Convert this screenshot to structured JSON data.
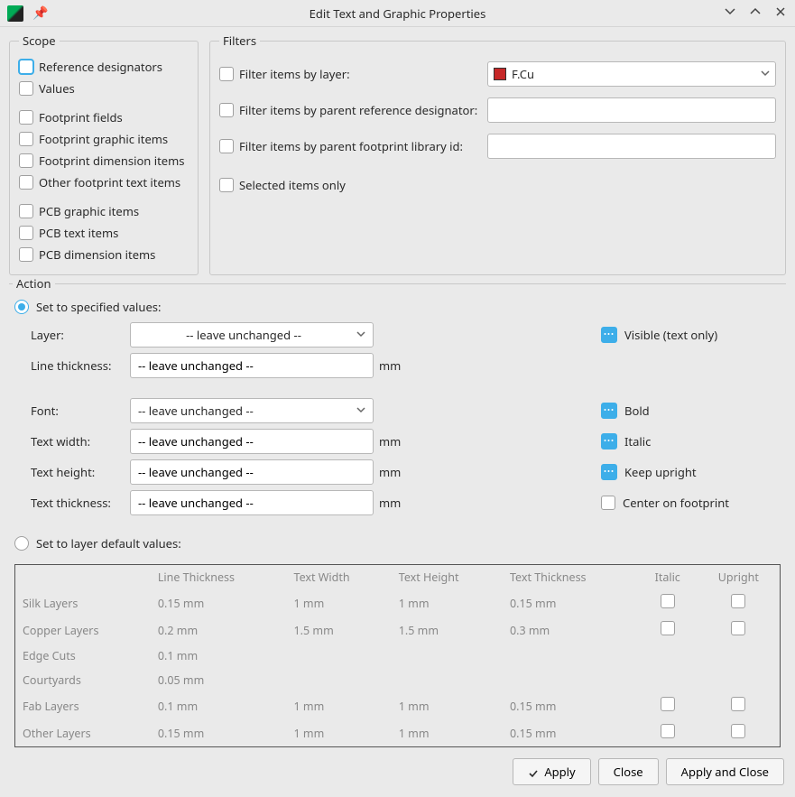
{
  "window": {
    "title": "Edit Text and Graphic Properties"
  },
  "scope": {
    "legend": "Scope",
    "items": [
      {
        "label": "Reference designators"
      },
      {
        "label": "Values"
      },
      null,
      {
        "label": "Footprint fields"
      },
      {
        "label": "Footprint graphic items"
      },
      {
        "label": "Footprint dimension items"
      },
      {
        "label": "Other footprint text items"
      },
      null,
      {
        "label": "PCB graphic items"
      },
      {
        "label": "PCB text items"
      },
      {
        "label": "PCB dimension items"
      }
    ]
  },
  "filters": {
    "legend": "Filters",
    "by_layer_label": "Filter items by layer:",
    "by_layer_value": "F.Cu",
    "by_parent_refdes_label": "Filter items by parent reference designator:",
    "by_parent_refdes_value": "",
    "by_parent_libid_label": "Filter items by parent footprint library id:",
    "by_parent_libid_value": "",
    "selected_only_label": "Selected items only"
  },
  "action": {
    "legend": "Action",
    "set_specified_label": "Set to specified values:",
    "set_defaults_label": "Set to layer default values:",
    "leave_unchanged": "-- leave unchanged --",
    "unit_mm": "mm",
    "rows": {
      "layer_label": "Layer:",
      "line_thickness_label": "Line thickness:",
      "font_label": "Font:",
      "text_width_label": "Text width:",
      "text_height_label": "Text height:",
      "text_thickness_label": "Text thickness:"
    },
    "checks": {
      "visible": "Visible  (text only)",
      "bold": "Bold",
      "italic": "Italic",
      "keep_upright": "Keep upright",
      "center_on_footprint": "Center on footprint"
    }
  },
  "defaults_table": {
    "headers": [
      "",
      "Line Thickness",
      "Text Width",
      "Text Height",
      "Text Thickness",
      "Italic",
      "Upright"
    ],
    "rows": [
      {
        "name": "Silk Layers",
        "line": "0.15 mm",
        "tw": "1 mm",
        "th": "1 mm",
        "tt": "0.15 mm",
        "checks": true
      },
      {
        "name": "Copper Layers",
        "line": "0.2 mm",
        "tw": "1.5 mm",
        "th": "1.5 mm",
        "tt": "0.3 mm",
        "checks": true
      },
      {
        "name": "Edge Cuts",
        "line": "0.1 mm",
        "tw": "",
        "th": "",
        "tt": "",
        "checks": false
      },
      {
        "name": "Courtyards",
        "line": "0.05 mm",
        "tw": "",
        "th": "",
        "tt": "",
        "checks": false
      },
      {
        "name": "Fab Layers",
        "line": "0.1 mm",
        "tw": "1 mm",
        "th": "1 mm",
        "tt": "0.15 mm",
        "checks": true
      },
      {
        "name": "Other Layers",
        "line": "0.15 mm",
        "tw": "1 mm",
        "th": "1 mm",
        "tt": "0.15 mm",
        "checks": true
      }
    ]
  },
  "buttons": {
    "apply": "Apply",
    "close": "Close",
    "apply_and_close": "Apply and Close"
  }
}
